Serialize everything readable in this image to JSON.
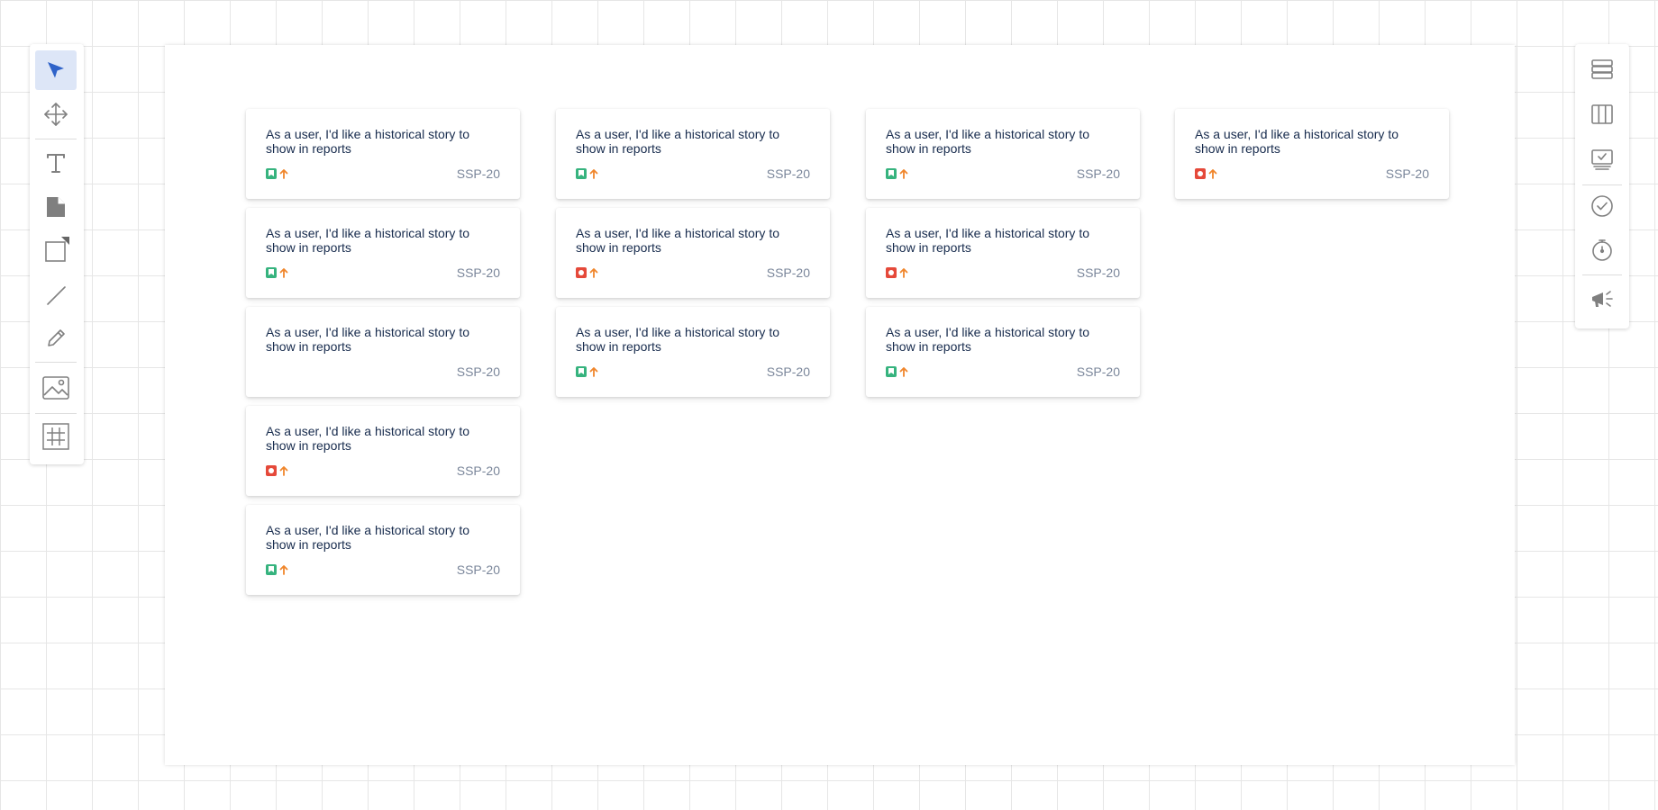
{
  "left_toolbar": {
    "tools": [
      {
        "name": "select-tool",
        "icon": "cursor-arrow-icon",
        "active": true
      },
      {
        "name": "pan-tool",
        "icon": "move-arrows-icon"
      },
      {
        "name": "text-tool",
        "icon": "text-t-icon"
      },
      {
        "name": "sticky-note-tool",
        "icon": "sticky-note-icon"
      },
      {
        "name": "shape-tool",
        "icon": "rectangle-icon"
      },
      {
        "name": "line-tool",
        "icon": "line-icon"
      },
      {
        "name": "pen-tool",
        "icon": "pencil-icon"
      },
      {
        "name": "image-tool",
        "icon": "image-icon"
      },
      {
        "name": "frame-tool",
        "icon": "frame-icon"
      }
    ]
  },
  "right_toolbar": {
    "tools": [
      {
        "name": "backlog-tool",
        "icon": "stacked-list-icon"
      },
      {
        "name": "board-tool",
        "icon": "columns-icon"
      },
      {
        "name": "sprint-tool",
        "icon": "monitor-check-icon"
      },
      {
        "name": "done-tool",
        "icon": "check-circle-icon"
      },
      {
        "name": "timer-tool",
        "icon": "stopwatch-icon"
      },
      {
        "name": "announce-tool",
        "icon": "megaphone-icon"
      }
    ]
  },
  "columns": [
    {
      "cards": [
        {
          "summary": "As a user, I'd like a historical story to show in reports",
          "type": "story",
          "priority": "high",
          "key": "SSP-20"
        },
        {
          "summary": "As a user, I'd like a historical story to show in reports",
          "type": "story",
          "priority": "high",
          "key": "SSP-20"
        },
        {
          "summary": "As a user, I'd like a historical story to show in reports",
          "type": null,
          "priority": null,
          "key": "SSP-20"
        },
        {
          "summary": "As a user, I'd like a historical story to show in reports",
          "type": "bug",
          "priority": "high",
          "key": "SSP-20"
        },
        {
          "summary": "As a user, I'd like a historical story to show in reports",
          "type": "story",
          "priority": "high",
          "key": "SSP-20"
        }
      ]
    },
    {
      "cards": [
        {
          "summary": "As a user, I'd like a historical story to show in reports",
          "type": "story",
          "priority": "high",
          "key": "SSP-20"
        },
        {
          "summary": "As a user, I'd like a historical story to show in reports",
          "type": "bug",
          "priority": "high",
          "key": "SSP-20"
        },
        {
          "summary": "As a user, I'd like a historical story to show in reports",
          "type": "story",
          "priority": "high",
          "key": "SSP-20"
        }
      ]
    },
    {
      "cards": [
        {
          "summary": "As a user, I'd like a historical story to show in reports",
          "type": "story",
          "priority": "high",
          "key": "SSP-20"
        },
        {
          "summary": "As a user, I'd like a historical story to show in reports",
          "type": "bug",
          "priority": "high",
          "key": "SSP-20"
        },
        {
          "summary": "As a user, I'd like a historical story to show in reports",
          "type": "story",
          "priority": "high",
          "key": "SSP-20"
        }
      ]
    },
    {
      "cards": [
        {
          "summary": "As a user, I'd like a historical story to show in reports",
          "type": "bug",
          "priority": "high",
          "key": "SSP-20"
        }
      ]
    }
  ],
  "colors": {
    "story": "#36b37e",
    "bug": "#e5493a",
    "priority_high": "#f0862b",
    "active_tool_bg": "#dde6f7",
    "active_tool_icon": "#2f63c9"
  }
}
